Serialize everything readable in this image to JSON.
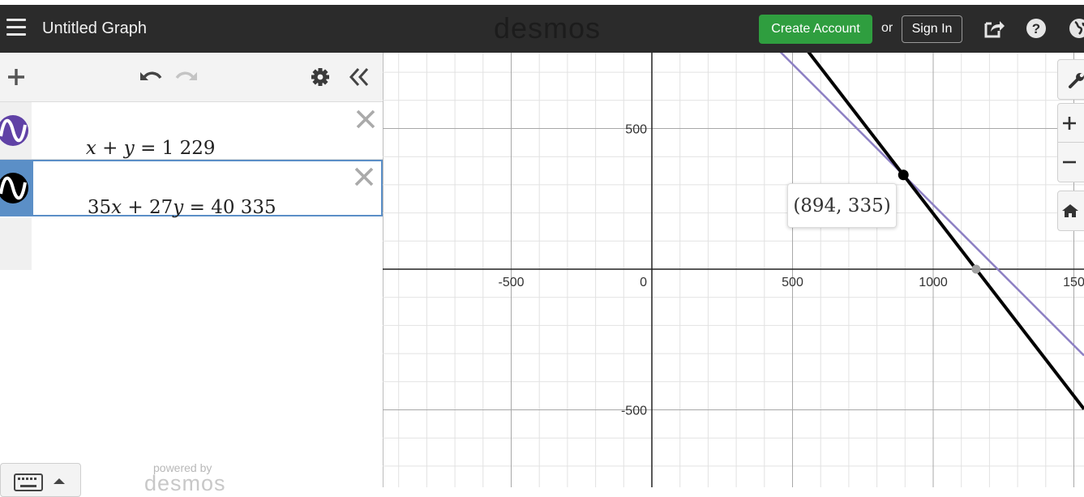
{
  "app": {
    "brand": "desmos",
    "title": "Untitled Graph"
  },
  "header": {
    "create_account": "Create Account",
    "or": "or",
    "sign_in": "Sign In"
  },
  "expressions": [
    {
      "latex": "x + y = 1 229",
      "color": "#6042a6"
    },
    {
      "latex": "35x + 27y = 40 335",
      "color": "#000000"
    }
  ],
  "footer": {
    "powered_by": "powered by",
    "logo": "desmos"
  },
  "graph": {
    "x_ticks": [
      "-500",
      "0",
      "500",
      "1000",
      "150"
    ],
    "y_ticks": [
      "500",
      "-500"
    ],
    "point_label": "(894, 335)",
    "intersection": [
      894,
      335
    ],
    "lines": [
      {
        "a": 1,
        "b": 1,
        "c": 1229,
        "color": "#8c7fc3"
      },
      {
        "a": 35,
        "b": 27,
        "c": 40335,
        "color": "#000000"
      }
    ]
  },
  "colors": {
    "header_bg": "#2b2b2b",
    "accent_green": "#2f9e3f",
    "selected_tab": "#5b8fc7"
  }
}
